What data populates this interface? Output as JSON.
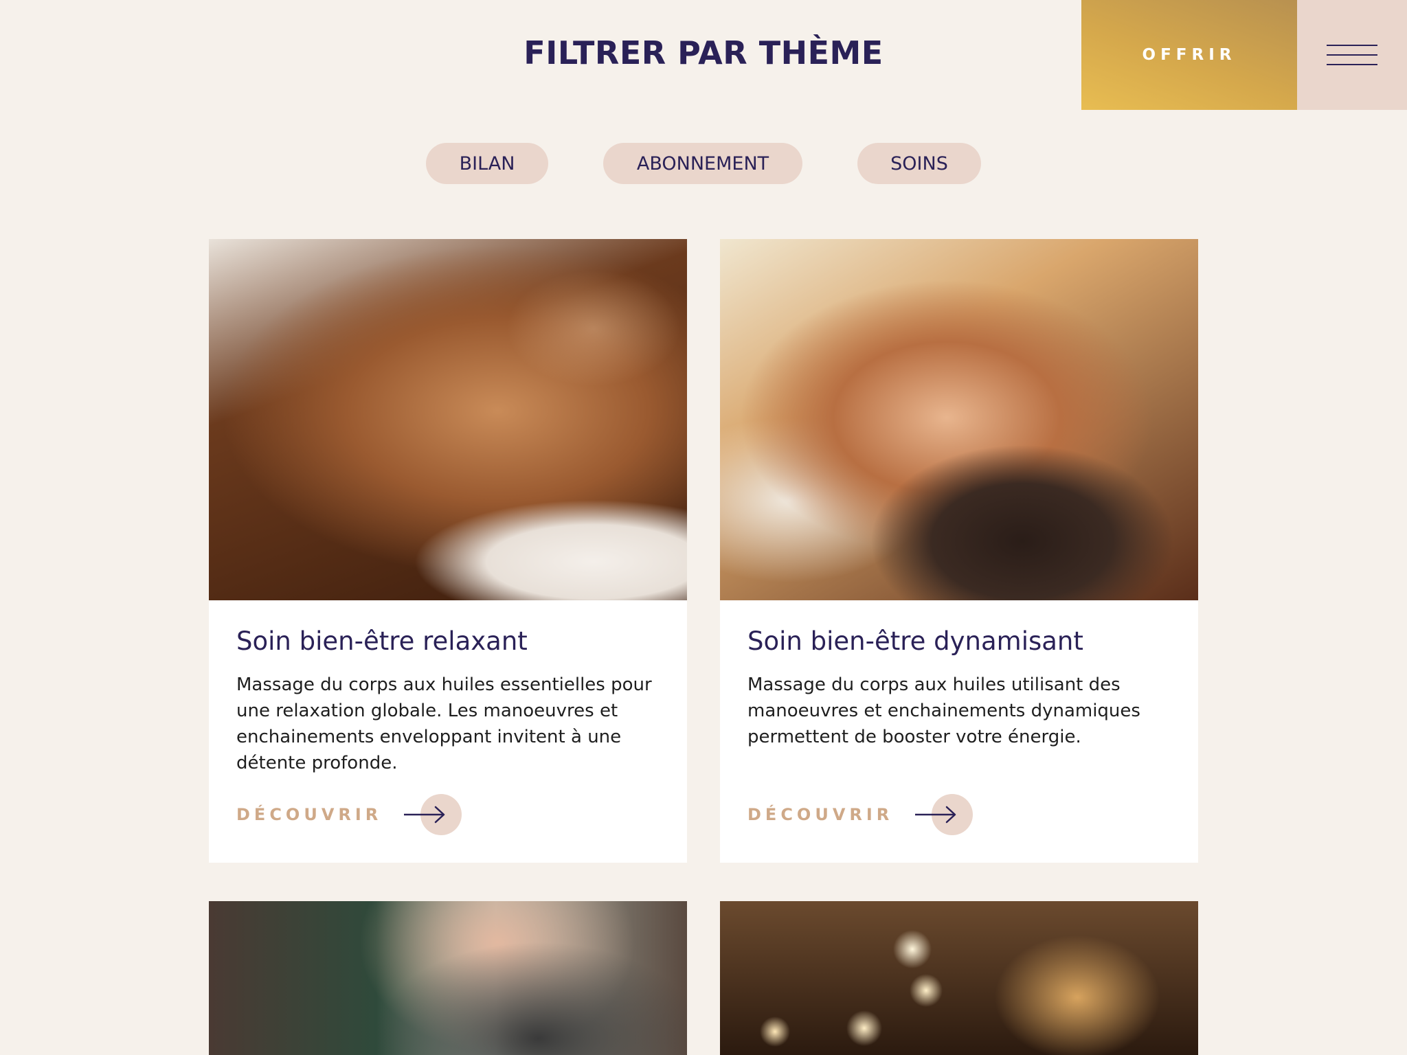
{
  "header": {
    "title": "FILTRER PAR THÈME",
    "offer_label": "OFFRIR",
    "menu_icon": "hamburger-menu-icon"
  },
  "filters": [
    {
      "label": "BILAN"
    },
    {
      "label": "ABONNEMENT"
    },
    {
      "label": "SOINS"
    }
  ],
  "cards": [
    {
      "title": "Soin bien-être relaxant",
      "description": "Massage du corps aux huiles essentielles pour une relaxation globale. Les manoeuvres et enchainements enveloppant invitent à une détente profonde.",
      "cta": "DÉCOUVRIR"
    },
    {
      "title": "Soin bien-être dynamisant",
      "description": "Massage du corps aux huiles utilisant des manoeuvres et enchainements dynamiques permettent de booster votre énergie.",
      "cta": "DÉCOUVRIR"
    }
  ],
  "colors": {
    "background": "#f6f1eb",
    "brand_navy": "#2a2157",
    "gold": "#d5a84c",
    "pill": "#ead6cc",
    "cta_text": "#cfa988"
  }
}
